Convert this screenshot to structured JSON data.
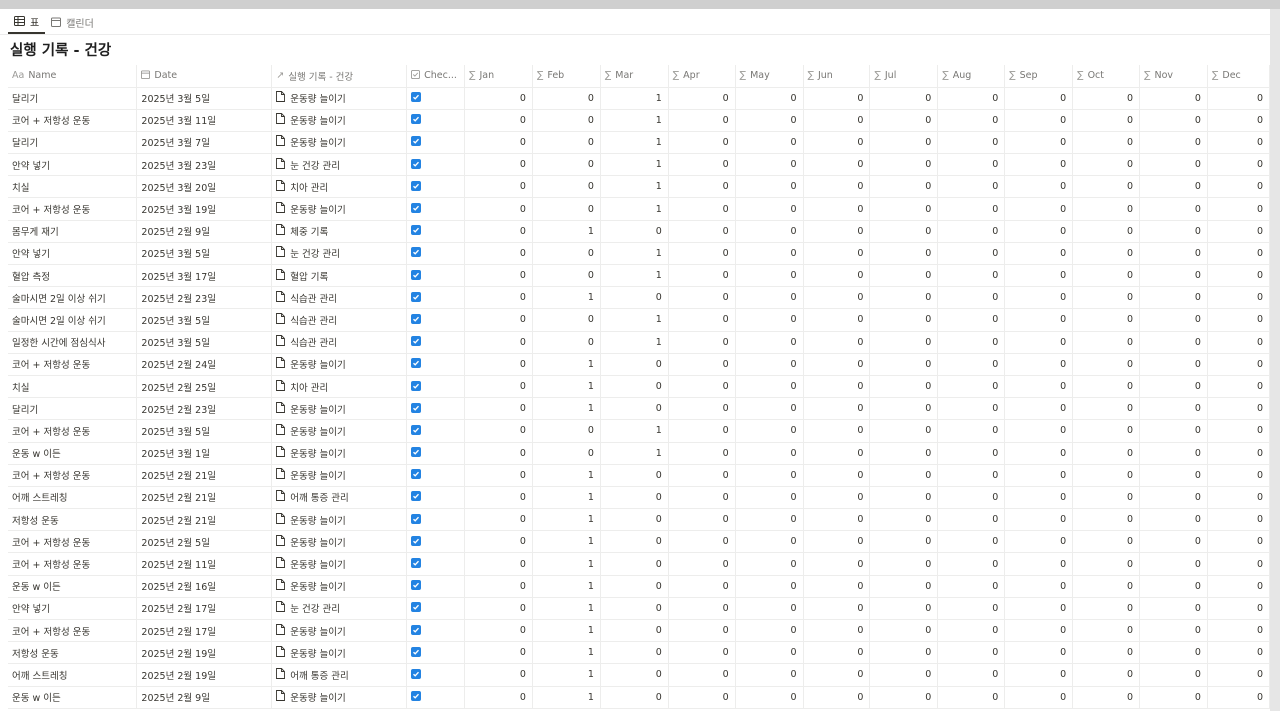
{
  "tabs": [
    {
      "label": "표",
      "icon": "table-icon",
      "active": true
    },
    {
      "label": "캘린더",
      "icon": "calendar-icon",
      "active": false
    }
  ],
  "page_title": "실행 기록 - 건강",
  "columns": {
    "name": "Name",
    "date": "Date",
    "relation": "실행 기록 - 건강",
    "check": "Chec...",
    "months": [
      "Jan",
      "Feb",
      "Mar",
      "Apr",
      "May",
      "Jun",
      "Jul",
      "Aug",
      "Sep",
      "Oct",
      "Nov",
      "Dec"
    ]
  },
  "colors": {
    "accent": "#2383e2",
    "border": "#ededec",
    "header_text": "#787774"
  },
  "rows": [
    {
      "name": "달리기",
      "date": "2025년 3월 5일",
      "relation": "운동량 늘이기",
      "months": [
        "0",
        "0",
        "1",
        "0",
        "0",
        "0",
        "0",
        "0",
        "0",
        "0",
        "0",
        "0"
      ]
    },
    {
      "name": "코어 + 저항성 운동",
      "date": "2025년 3월 11일",
      "relation": "운동량 늘이기",
      "months": [
        "0",
        "0",
        "1",
        "0",
        "0",
        "0",
        "0",
        "0",
        "0",
        "0",
        "0",
        "0"
      ]
    },
    {
      "name": "달리기",
      "date": "2025년 3월 7일",
      "relation": "운동량 늘이기",
      "months": [
        "0",
        "0",
        "1",
        "0",
        "0",
        "0",
        "0",
        "0",
        "0",
        "0",
        "0",
        "0"
      ]
    },
    {
      "name": "안약 넣기",
      "date": "2025년 3월 23일",
      "relation": "눈 건강 관리",
      "months": [
        "0",
        "0",
        "1",
        "0",
        "0",
        "0",
        "0",
        "0",
        "0",
        "0",
        "0",
        "0"
      ]
    },
    {
      "name": "치실",
      "date": "2025년 3월 20일",
      "relation": "치아 관리",
      "months": [
        "0",
        "0",
        "1",
        "0",
        "0",
        "0",
        "0",
        "0",
        "0",
        "0",
        "0",
        "0"
      ]
    },
    {
      "name": "코어 + 저항성 운동",
      "date": "2025년 3월 19일",
      "relation": "운동량 늘이기",
      "months": [
        "0",
        "0",
        "1",
        "0",
        "0",
        "0",
        "0",
        "0",
        "0",
        "0",
        "0",
        "0"
      ]
    },
    {
      "name": "몸무게 재기",
      "date": "2025년 2월 9일",
      "relation": "체중 기록",
      "months": [
        "0",
        "1",
        "0",
        "0",
        "0",
        "0",
        "0",
        "0",
        "0",
        "0",
        "0",
        "0"
      ]
    },
    {
      "name": "안약 넣기",
      "date": "2025년 3월 5일",
      "relation": "눈 건강 관리",
      "months": [
        "0",
        "0",
        "1",
        "0",
        "0",
        "0",
        "0",
        "0",
        "0",
        "0",
        "0",
        "0"
      ]
    },
    {
      "name": "혈압 측정",
      "date": "2025년 3월 17일",
      "relation": "혈압 기록",
      "months": [
        "0",
        "0",
        "1",
        "0",
        "0",
        "0",
        "0",
        "0",
        "0",
        "0",
        "0",
        "0"
      ]
    },
    {
      "name": "술마시면 2일 이상 쉬기",
      "date": "2025년 2월 23일",
      "relation": "식습관 관리",
      "months": [
        "0",
        "1",
        "0",
        "0",
        "0",
        "0",
        "0",
        "0",
        "0",
        "0",
        "0",
        "0"
      ]
    },
    {
      "name": "술마시면 2일 이상 쉬기",
      "date": "2025년 3월 5일",
      "relation": "식습관 관리",
      "months": [
        "0",
        "0",
        "1",
        "0",
        "0",
        "0",
        "0",
        "0",
        "0",
        "0",
        "0",
        "0"
      ]
    },
    {
      "name": "일정한 시간에 점심식사",
      "date": "2025년 3월 5일",
      "relation": "식습관 관리",
      "months": [
        "0",
        "0",
        "1",
        "0",
        "0",
        "0",
        "0",
        "0",
        "0",
        "0",
        "0",
        "0"
      ]
    },
    {
      "name": "코어 + 저항성 운동",
      "date": "2025년 2월 24일",
      "relation": "운동량 늘이기",
      "months": [
        "0",
        "1",
        "0",
        "0",
        "0",
        "0",
        "0",
        "0",
        "0",
        "0",
        "0",
        "0"
      ]
    },
    {
      "name": "치실",
      "date": "2025년 2월 25일",
      "relation": "치아 관리",
      "months": [
        "0",
        "1",
        "0",
        "0",
        "0",
        "0",
        "0",
        "0",
        "0",
        "0",
        "0",
        "0"
      ]
    },
    {
      "name": "달리기",
      "date": "2025년 2월 23일",
      "relation": "운동량 늘이기",
      "months": [
        "0",
        "1",
        "0",
        "0",
        "0",
        "0",
        "0",
        "0",
        "0",
        "0",
        "0",
        "0"
      ]
    },
    {
      "name": "코어 + 저항성 운동",
      "date": "2025년 3월 5일",
      "relation": "운동량 늘이기",
      "months": [
        "0",
        "0",
        "1",
        "0",
        "0",
        "0",
        "0",
        "0",
        "0",
        "0",
        "0",
        "0"
      ]
    },
    {
      "name": "운동 w 이든",
      "date": "2025년 3월 1일",
      "relation": "운동량 늘이기",
      "months": [
        "0",
        "0",
        "1",
        "0",
        "0",
        "0",
        "0",
        "0",
        "0",
        "0",
        "0",
        "0"
      ]
    },
    {
      "name": "코어 + 저항성 운동",
      "date": "2025년 2월 21일",
      "relation": "운동량 늘이기",
      "months": [
        "0",
        "1",
        "0",
        "0",
        "0",
        "0",
        "0",
        "0",
        "0",
        "0",
        "0",
        "0"
      ]
    },
    {
      "name": "어깨 스트레칭",
      "date": "2025년 2월 21일",
      "relation": "어깨 통증 관리",
      "months": [
        "0",
        "1",
        "0",
        "0",
        "0",
        "0",
        "0",
        "0",
        "0",
        "0",
        "0",
        "0"
      ]
    },
    {
      "name": "저항성 운동",
      "date": "2025년 2월 21일",
      "relation": "운동량 늘이기",
      "months": [
        "0",
        "1",
        "0",
        "0",
        "0",
        "0",
        "0",
        "0",
        "0",
        "0",
        "0",
        "0"
      ]
    },
    {
      "name": "코어 + 저항성 운동",
      "date": "2025년 2월 5일",
      "relation": "운동량 늘이기",
      "months": [
        "0",
        "1",
        "0",
        "0",
        "0",
        "0",
        "0",
        "0",
        "0",
        "0",
        "0",
        "0"
      ]
    },
    {
      "name": "코어 + 저항성 운동",
      "date": "2025년 2월 11일",
      "relation": "운동량 늘이기",
      "months": [
        "0",
        "1",
        "0",
        "0",
        "0",
        "0",
        "0",
        "0",
        "0",
        "0",
        "0",
        "0"
      ]
    },
    {
      "name": "운동 w 이든",
      "date": "2025년 2월 16일",
      "relation": "운동량 늘이기",
      "months": [
        "0",
        "1",
        "0",
        "0",
        "0",
        "0",
        "0",
        "0",
        "0",
        "0",
        "0",
        "0"
      ]
    },
    {
      "name": "안약 넣기",
      "date": "2025년 2월 17일",
      "relation": "눈 건강 관리",
      "months": [
        "0",
        "1",
        "0",
        "0",
        "0",
        "0",
        "0",
        "0",
        "0",
        "0",
        "0",
        "0"
      ]
    },
    {
      "name": "코어 + 저항성 운동",
      "date": "2025년 2월 17일",
      "relation": "운동량 늘이기",
      "months": [
        "0",
        "1",
        "0",
        "0",
        "0",
        "0",
        "0",
        "0",
        "0",
        "0",
        "0",
        "0"
      ]
    },
    {
      "name": "저항성 운동",
      "date": "2025년 2월 19일",
      "relation": "운동량 늘이기",
      "months": [
        "0",
        "1",
        "0",
        "0",
        "0",
        "0",
        "0",
        "0",
        "0",
        "0",
        "0",
        "0"
      ]
    },
    {
      "name": "어깨 스트레칭",
      "date": "2025년 2월 19일",
      "relation": "어깨 통증 관리",
      "months": [
        "0",
        "1",
        "0",
        "0",
        "0",
        "0",
        "0",
        "0",
        "0",
        "0",
        "0",
        "0"
      ]
    },
    {
      "name": "운동 w 이든",
      "date": "2025년 2월 9일",
      "relation": "운동량 늘이기",
      "months": [
        "0",
        "1",
        "0",
        "0",
        "0",
        "0",
        "0",
        "0",
        "0",
        "0",
        "0",
        "0"
      ]
    }
  ]
}
